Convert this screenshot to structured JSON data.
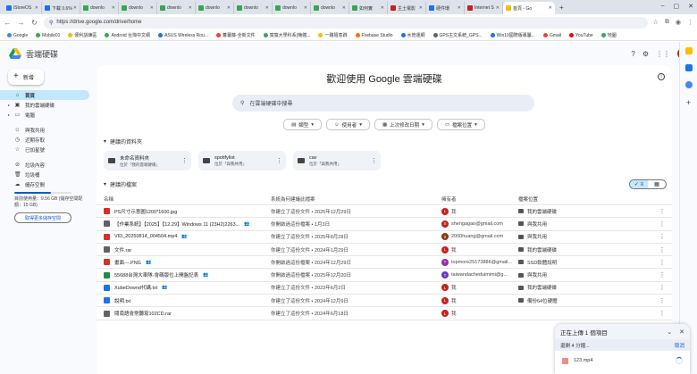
{
  "browser": {
    "tabs": [
      {
        "label": "iStoreOS",
        "color": "#1a73e8"
      },
      {
        "label": "下載 0.6%",
        "color": "#1a73e8"
      },
      {
        "label": "downlo",
        "color": "#34a853"
      },
      {
        "label": "downlo",
        "color": "#34a853"
      },
      {
        "label": "downlo",
        "color": "#34a853"
      },
      {
        "label": "downlo",
        "color": "#34a853"
      },
      {
        "label": "downlo",
        "color": "#34a853"
      },
      {
        "label": "downlo",
        "color": "#34a853"
      },
      {
        "label": "downlo",
        "color": "#34a853"
      },
      {
        "label": "如何實",
        "color": "#34a853"
      },
      {
        "label": "主土電影",
        "color": "#c5221f"
      },
      {
        "label": "硬件環",
        "color": "#1a73e8"
      },
      {
        "label": "Internet S",
        "color": "#c5221f"
      }
    ],
    "active_tab": "首頁 - Go",
    "url": "https://drive.google.com/drive/home",
    "bookmarks": [
      {
        "label": "Google",
        "color": "#4285f4"
      },
      {
        "label": "Mobile01",
        "color": "#34a853"
      },
      {
        "label": "便利訓練區",
        "color": "#fbbc04"
      },
      {
        "label": "Android 台灣中文網",
        "color": "#34a853"
      },
      {
        "label": "ASUS Wireless Rou...",
        "color": "#1a73e8"
      },
      {
        "label": "蕃薯藤-全新文件",
        "color": "#ea4335"
      },
      {
        "label": "寬寬大學科系(簡體...",
        "color": "#34a853"
      },
      {
        "label": "一路隨意跳",
        "color": "#fbbc04"
      },
      {
        "label": "Firebase Studio",
        "color": "#ff6f00"
      },
      {
        "label": "水管運網",
        "color": "#1a73e8"
      },
      {
        "label": "GPS主文系統_GPS...",
        "color": "#5f6368"
      },
      {
        "label": "Win10國際版專屬...",
        "color": "#1a73e8"
      },
      {
        "label": "Gmail",
        "color": "#ea4335"
      },
      {
        "label": "YouTube",
        "color": "#ff0000"
      },
      {
        "label": "地圖",
        "color": "#34a853"
      }
    ]
  },
  "app": {
    "title": "雲端硬碟",
    "avatar_letter": "L",
    "new_label": "新增"
  },
  "nav": {
    "items": [
      {
        "label": "首頁",
        "icon": "home-icon",
        "glyph": "⌂"
      },
      {
        "label": "我的雲端硬碟",
        "icon": "drive-icon",
        "glyph": "▣"
      },
      {
        "label": "電腦",
        "icon": "computer-icon",
        "glyph": "▭"
      },
      {
        "label": "與我共用",
        "icon": "people-icon",
        "glyph": "☺"
      },
      {
        "label": "近期存取",
        "icon": "clock-icon",
        "glyph": "◷"
      },
      {
        "label": "已加星號",
        "icon": "star-icon",
        "glyph": "☆"
      },
      {
        "label": "垃圾內容",
        "icon": "spam-icon",
        "glyph": "⊘"
      },
      {
        "label": "垃圾桶",
        "icon": "trash-icon",
        "glyph": "🗑"
      },
      {
        "label": "儲存空間",
        "icon": "cloud-icon",
        "glyph": "☁"
      }
    ],
    "storage_used": "目前使用量：9.56 GB (儲存空間配額：15 GB)",
    "storage_fraction": 0.64,
    "get_storage": "取得更多儲存空間"
  },
  "main": {
    "welcome": "歡迎使用 Google 雲端硬碟",
    "search_placeholder": "在雲端硬碟中搜尋",
    "filters": [
      "類型",
      "使用者",
      "上次修改日期",
      "檔案位置"
    ],
    "folders_heading": "建議的資料夾",
    "folders": [
      {
        "name": "未命名資料夾",
        "sub": "位於「我的雲端硬碟」"
      },
      {
        "name": "spotifylist",
        "sub": "位於「與我共用」"
      },
      {
        "name": "cav",
        "sub": "位於「與我共用」"
      }
    ],
    "files_heading": "建議的檔案",
    "columns": {
      "name": "名稱",
      "reason": "系統為何建議此檔案",
      "owner": "擁有者",
      "location": "檔案位置"
    },
    "rows": [
      {
        "name": "PS尺寸示意圖1200*1600.jpg",
        "reason": "你建立了這份文件 • 2025年12月29日",
        "owner": "我",
        "oav": "L",
        "ocolor": "#c5221f",
        "location": "我的雲端硬碟",
        "type_color": "#d93025",
        "shared": false
      },
      {
        "name": "【作業系統】【2025】【12.29】Windows 11 (23H2)2263...",
        "reason": "你開啟過這份檔案 • 1月3日",
        "owner": "shengagao@gmail.com",
        "oav": "S",
        "ocolor": "#b3261e",
        "location": "與我共用",
        "type_color": "#5f6368",
        "shared": true
      },
      {
        "name": "VID_20250814_004504.mp4",
        "reason": "你建立了這份文件 • 2025年8月28日",
        "owner": "2000huang@gmail.com",
        "oav": "2",
        "ocolor": "#8d3b16",
        "location": "與我共用",
        "type_color": "#d93025",
        "shared": true
      },
      {
        "name": "文件.rar",
        "reason": "你建立了這份文件 • 2024年1月29日",
        "owner": "我",
        "oav": "L",
        "ocolor": "#c5221f",
        "location": "我的雲端硬碟",
        "type_color": "#5f6368",
        "shared": false
      },
      {
        "name": "畫面---.PNG",
        "reason": "你開啟過這份檔案 • 2024年12月29日",
        "owner": "topmore25173886@gmail...",
        "oav": "T",
        "ocolor": "#9c27b0",
        "location": "SSD軟體說明",
        "type_color": "#d93025",
        "shared": true
      },
      {
        "name": "55688台灣大車隊-會碼版位上開盤記表",
        "reason": "你開啟過這份檔案 • 2025年12月20日",
        "owner": "taiwandacheduimimi@g...",
        "oav": "T",
        "ocolor": "#673ab7",
        "location": "與我共用",
        "type_color": "#1e8e3e",
        "shared": true
      },
      {
        "name": "XubeDownd代碼.txt",
        "reason": "你建立了這份文件 • 2023年6月2日",
        "owner": "我",
        "oav": "L",
        "ocolor": "#c5221f",
        "location": "我的雲端硬碟",
        "type_color": "#1a73e8",
        "shared": true
      },
      {
        "name": "說明.txt",
        "reason": "你建立了這份文件 • 2024年12月9日",
        "owner": "我",
        "oav": "L",
        "ocolor": "#c5221f",
        "location": "備份64位硬體",
        "type_color": "#1a73e8",
        "shared": false
      },
      {
        "name": "閱南語會常聽寫102CD.rar",
        "reason": "你建立了這份文件 • 2024年6月18日",
        "owner": "我",
        "oav": "L",
        "ocolor": "#c5221f",
        "location": "",
        "type_color": "#5f6368",
        "shared": false
      }
    ]
  },
  "upload": {
    "title": "正在上傳 1 個項目",
    "status": "還剩 4 分鐘...",
    "cancel": "取消",
    "file": "123.mp4"
  }
}
